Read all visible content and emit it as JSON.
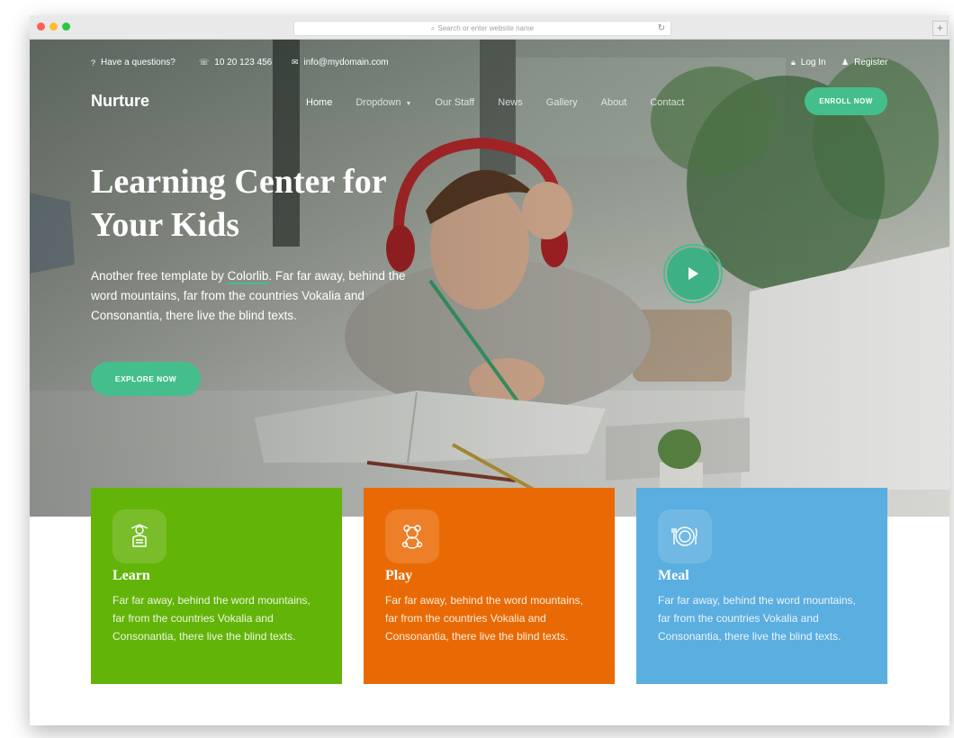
{
  "browser": {
    "url_placeholder": "Search or enter website name",
    "new_tab_label": "+"
  },
  "topbar": {
    "question": "Have a questions?",
    "phone": "10 20 123 456",
    "email": "info@mydomain.com",
    "login": "Log In",
    "register": "Register"
  },
  "brand": "Nurture",
  "nav": {
    "items": [
      "Home",
      "Dropdown",
      "Our Staff",
      "News",
      "Gallery",
      "About",
      "Contact"
    ],
    "active": "Home"
  },
  "enroll_label": "ENROLL NOW",
  "hero": {
    "title_line1": "Learning Center for",
    "title_line2": "Your Kids",
    "sub_before": "Another free template by ",
    "sub_link": "Colorlib",
    "sub_after": ". Far far away, behind the word mountains, far from the countries Vokalia and Consonantia, there live the blind texts.",
    "button": "EXPLORE NOW"
  },
  "cards": [
    {
      "title": "Learn",
      "text": "Far far away, behind the word mountains, far from the countries Vokalia and Consonantia, there live the blind texts.",
      "color": "#63b408",
      "icon": "reader-icon"
    },
    {
      "title": "Play",
      "text": "Far far away, behind the word mountains, far from the countries Vokalia and Consonantia, there live the blind texts.",
      "color": "#e96a04",
      "icon": "teddy-bear-icon"
    },
    {
      "title": "Meal",
      "text": "Far far away, behind the word mountains, far from the countries Vokalia and Consonantia, there live the blind texts.",
      "color": "#5aaee0",
      "icon": "meal-plate-icon"
    }
  ],
  "colors": {
    "accent": "#44bf8b"
  }
}
